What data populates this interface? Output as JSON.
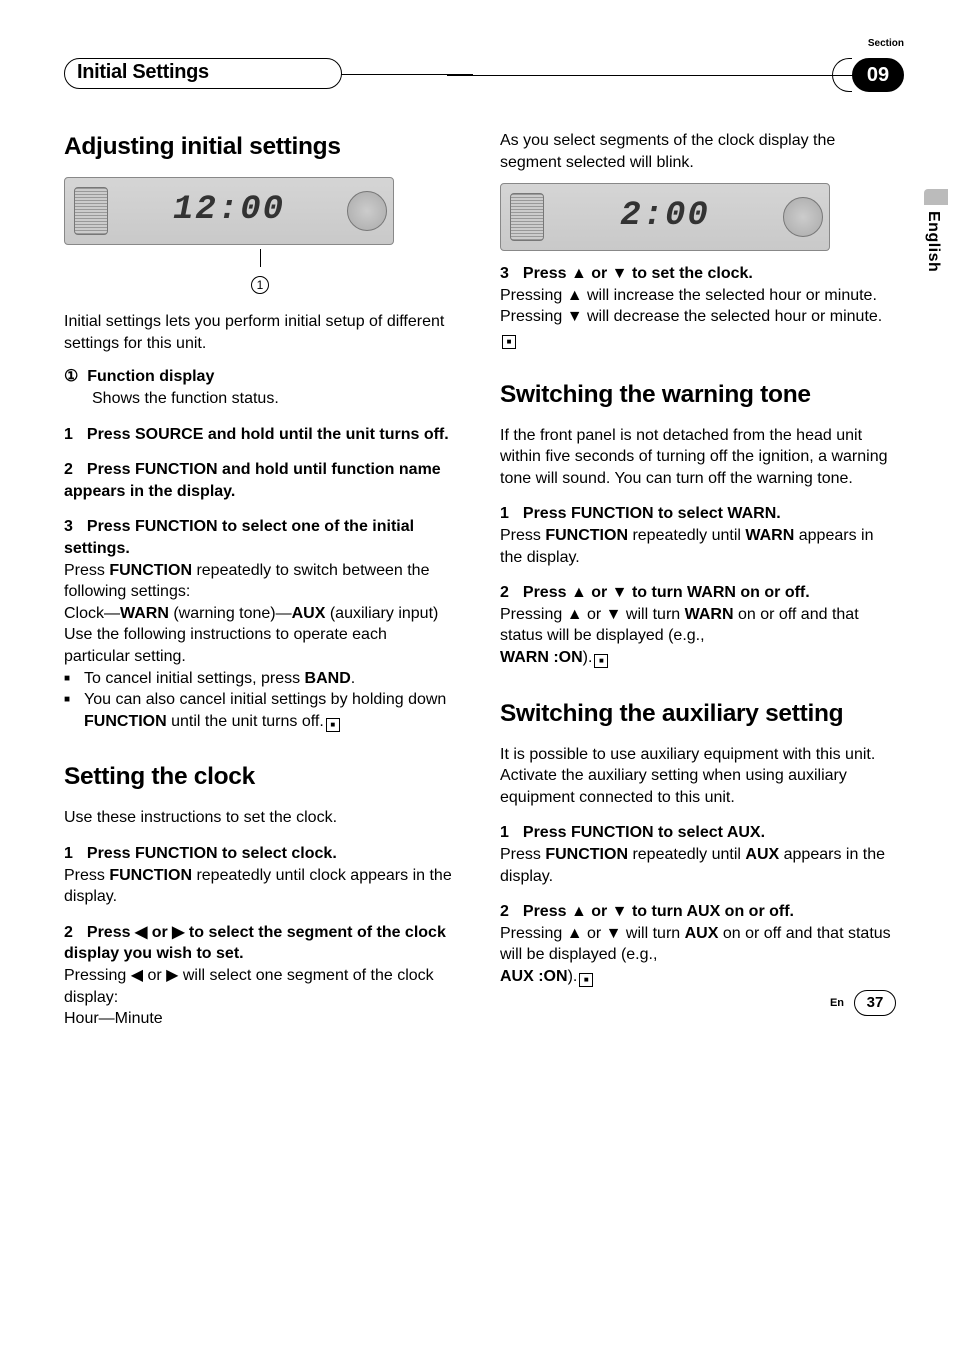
{
  "header": {
    "sectionLabel": "Section",
    "chapter": "Initial Settings",
    "num": "09"
  },
  "side": {
    "lang": "English"
  },
  "footer": {
    "langAbbr": "En",
    "page": "37"
  },
  "left": {
    "h1a": "Adjusting initial settings",
    "lcd1": "12:00",
    "calloutNum": "1",
    "introA": "Initial settings lets you perform initial setup of different settings for this unit.",
    "fd_num": "①",
    "fd_title": "Function display",
    "fd_body": "Shows the function status.",
    "s1n": "1",
    "s1": "Press SOURCE and hold until the unit turns off.",
    "s2n": "2",
    "s2": "Press FUNCTION and hold until function name appears in the display.",
    "s3n": "3",
    "s3": "Press FUNCTION to select one of the initial settings.",
    "s3b_a": "Press ",
    "s3b_b": "FUNCTION",
    "s3b_c": " repeatedly to switch between the following settings:",
    "s3c_a": "Clock—",
    "s3c_b": "WARN",
    "s3c_c": " (warning tone)—",
    "s3c_d": "AUX",
    "s3c_e": " (auxiliary input)",
    "s3d": "Use the following instructions to operate each particular setting.",
    "bul1_a": "To cancel initial settings, press ",
    "bul1_b": "BAND",
    "bul1_c": ".",
    "bul2_a": "You can also cancel initial settings by holding down ",
    "bul2_b": "FUNCTION",
    "bul2_c": " until the unit turns off.",
    "h1b": "Setting the clock",
    "introB": "Use these instructions to set the clock.",
    "c1n": "1",
    "c1": "Press FUNCTION to select clock.",
    "c1b_a": "Press ",
    "c1b_b": "FUNCTION",
    "c1b_c": " repeatedly until clock appears in the display.",
    "c2n": "2",
    "c2": "Press ◀ or ▶ to select the segment of the clock display you wish to set.",
    "c2b": "Pressing ◀ or ▶ will select one segment of the clock display:",
    "c2c": "Hour—Minute"
  },
  "right": {
    "topA": "As you select segments of the clock display the segment selected will blink.",
    "lcd2": "2:00",
    "r3n": "3",
    "r3": "Press ▲ or ▼ to set the clock.",
    "r3b": "Pressing ▲ will increase the selected hour or minute. Pressing ▼ will decrease the selected hour or minute.",
    "h1c": "Switching the warning tone",
    "introC": "If the front panel is not detached from the head unit within five seconds of turning off the ignition, a warning tone will sound. You can turn off the warning tone.",
    "w1n": "1",
    "w1": "Press FUNCTION to select WARN.",
    "w1b_a": "Press ",
    "w1b_b": "FUNCTION",
    "w1b_c": " repeatedly until ",
    "w1b_d": "WARN",
    "w1b_e": " appears in the display.",
    "w2n": "2",
    "w2": "Press ▲ or ▼ to turn WARN on or off.",
    "w2b_a": "Pressing ▲ or ▼ will turn ",
    "w2b_b": "WARN",
    "w2b_c": " on or off and that status will be displayed (e.g., ",
    "w2b_d": "WARN :ON",
    "w2b_e": ").",
    "h1d": "Switching the auxiliary setting",
    "introD": "It is possible to use auxiliary equipment with this unit. Activate the auxiliary setting when using auxiliary equipment connected to this unit.",
    "a1n": "1",
    "a1": "Press FUNCTION to select AUX.",
    "a1b_a": "Press ",
    "a1b_b": "FUNCTION",
    "a1b_c": " repeatedly until ",
    "a1b_d": "AUX",
    "a1b_e": " appears in the display.",
    "a2n": "2",
    "a2": "Press ▲ or ▼ to turn AUX on or off.",
    "a2b_a": "Pressing ▲ or ▼ will turn ",
    "a2b_b": "AUX",
    "a2b_c": " on or off and that status will be displayed (e.g., ",
    "a2b_d": "AUX :ON",
    "a2b_e": ")."
  }
}
